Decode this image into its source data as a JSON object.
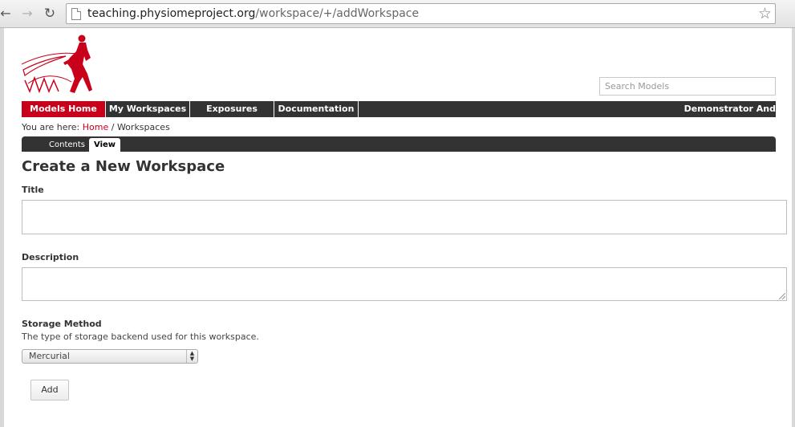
{
  "browser": {
    "url_host": "teaching.physiomeproject.org",
    "url_path": "/workspace/+/addWorkspace",
    "back_icon": "←",
    "forward_icon": "→",
    "reload_icon": "↻",
    "star_icon": "☆"
  },
  "header": {
    "search_placeholder": "Search Models"
  },
  "nav": {
    "items": [
      {
        "label": "Models Home"
      },
      {
        "label": "My Workspaces"
      },
      {
        "label": "Exposures"
      },
      {
        "label": "Documentation"
      }
    ],
    "right_label": "Demonstrator And"
  },
  "breadcrumb": {
    "prefix": "You are here:",
    "home": "Home",
    "separator": "/",
    "current": "Workspaces"
  },
  "tabs": [
    {
      "label": "Contents"
    },
    {
      "label": "View"
    }
  ],
  "form": {
    "heading": "Create a New Workspace",
    "title_label": "Title",
    "title_value": "",
    "description_label": "Description",
    "description_value": "",
    "storage_label": "Storage Method",
    "storage_help": "The type of storage backend used for this workspace.",
    "storage_selected": "Mercurial",
    "add_button": "Add"
  },
  "colors": {
    "accent": "#c8001a",
    "nav_bg": "#333333"
  }
}
